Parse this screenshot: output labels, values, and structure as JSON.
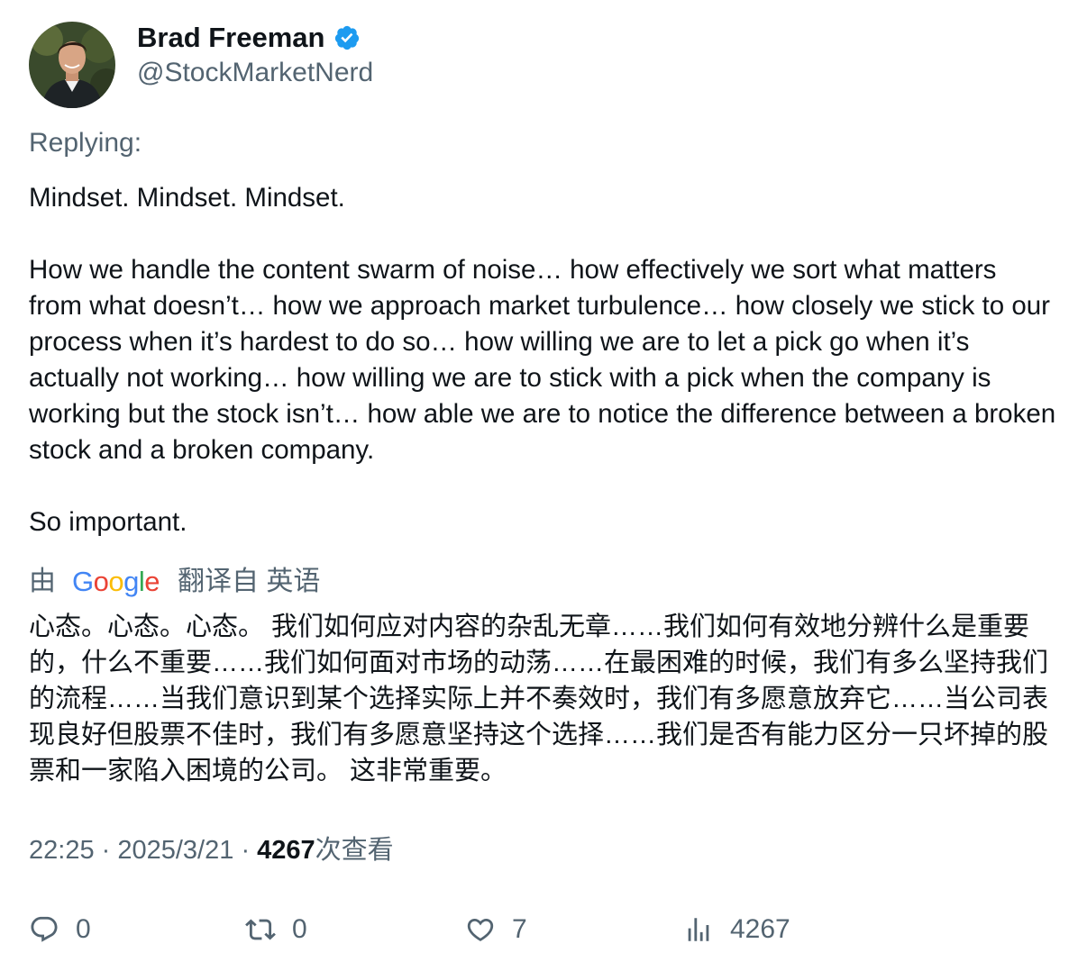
{
  "author": {
    "name": "Brad Freeman",
    "handle": "@StockMarketNerd",
    "verified": true,
    "avatar_icon": "profile-photo"
  },
  "replying_label": "Replying:",
  "tweet": {
    "paragraphs": [
      "Mindset. Mindset. Mindset.",
      "How we handle the content swarm of noise… how effectively we sort what matters from what doesn’t… how we approach market turbulence… how closely we stick to our process when it’s hardest to do so… how willing we are to let a pick go when it’s actually not working… how willing we are to stick with a pick when the company is working but the stock isn’t… how able we are to notice the difference between a broken stock and a broken company.",
      "So important."
    ]
  },
  "translation": {
    "by_label": "由",
    "provider": "Google",
    "from_label": "翻译自 英语",
    "text": "心态。心态。心态。 我们如何应对内容的杂乱无章……我们如何有效地分辨什么是重要的，什么不重要……我们如何面对市场的动荡……在最困难的时候，我们有多么坚持我们的流程……当我们意识到某个选择实际上并不奏效时，我们有多愿意放弃它……当公司表现良好但股票不佳时，我们有多愿意坚持这个选择……我们是否有能力区分一只坏掉的股票和一家陷入困境的公司。 这非常重要。"
  },
  "meta": {
    "time": "22:25",
    "separator": "·",
    "date": "2025/3/21",
    "views_count": "4267",
    "views_label": "次查看"
  },
  "actions": {
    "reply": {
      "icon": "reply-icon",
      "count": "0"
    },
    "retweet": {
      "icon": "retweet-icon",
      "count": "0"
    },
    "like": {
      "icon": "heart-icon",
      "count": "7"
    },
    "views": {
      "icon": "analytics-icon",
      "count": "4267"
    }
  },
  "colors": {
    "text_primary": "#0f1419",
    "text_secondary": "#536471",
    "verified_blue": "#1d9bf0"
  }
}
